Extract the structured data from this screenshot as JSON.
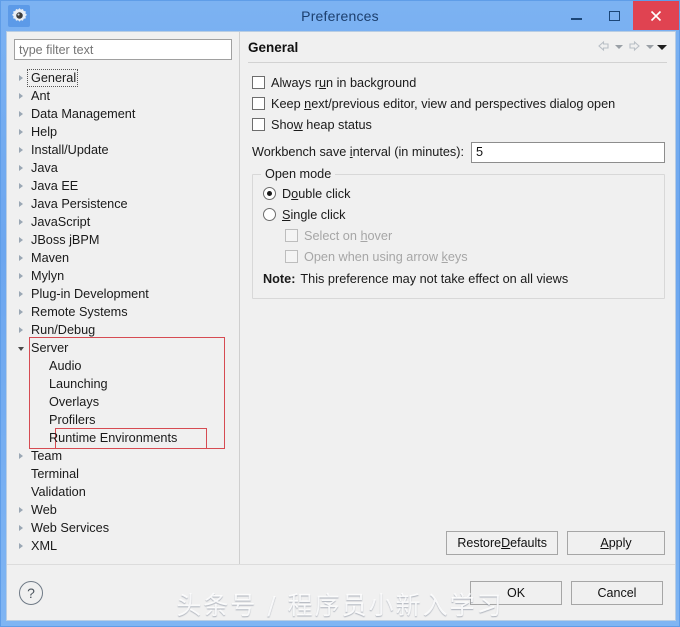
{
  "window": {
    "title": "Preferences",
    "icon": "preferences-gear-icon",
    "controls": {
      "minimize": "–",
      "maximize": "□",
      "close": "✕"
    }
  },
  "sidebar": {
    "filter": {
      "placeholder": "type filter text",
      "value": ""
    },
    "items": [
      {
        "label": "General",
        "expandable": true,
        "expanded": false,
        "level": 0,
        "focused": true
      },
      {
        "label": "Ant",
        "expandable": true,
        "expanded": false,
        "level": 0,
        "focused": false
      },
      {
        "label": "Data Management",
        "expandable": true,
        "expanded": false,
        "level": 0,
        "focused": false
      },
      {
        "label": "Help",
        "expandable": true,
        "expanded": false,
        "level": 0,
        "focused": false
      },
      {
        "label": "Install/Update",
        "expandable": true,
        "expanded": false,
        "level": 0,
        "focused": false
      },
      {
        "label": "Java",
        "expandable": true,
        "expanded": false,
        "level": 0,
        "focused": false
      },
      {
        "label": "Java EE",
        "expandable": true,
        "expanded": false,
        "level": 0,
        "focused": false
      },
      {
        "label": "Java Persistence",
        "expandable": true,
        "expanded": false,
        "level": 0,
        "focused": false
      },
      {
        "label": "JavaScript",
        "expandable": true,
        "expanded": false,
        "level": 0,
        "focused": false
      },
      {
        "label": "JBoss jBPM",
        "expandable": true,
        "expanded": false,
        "level": 0,
        "focused": false
      },
      {
        "label": "Maven",
        "expandable": true,
        "expanded": false,
        "level": 0,
        "focused": false
      },
      {
        "label": "Mylyn",
        "expandable": true,
        "expanded": false,
        "level": 0,
        "focused": false
      },
      {
        "label": "Plug-in Development",
        "expandable": true,
        "expanded": false,
        "level": 0,
        "focused": false
      },
      {
        "label": "Remote Systems",
        "expandable": true,
        "expanded": false,
        "level": 0,
        "focused": false
      },
      {
        "label": "Run/Debug",
        "expandable": true,
        "expanded": false,
        "level": 0,
        "focused": false
      },
      {
        "label": "Server",
        "expandable": true,
        "expanded": true,
        "level": 0,
        "focused": false
      },
      {
        "label": "Audio",
        "expandable": false,
        "expanded": false,
        "level": 1,
        "focused": false
      },
      {
        "label": "Launching",
        "expandable": false,
        "expanded": false,
        "level": 1,
        "focused": false
      },
      {
        "label": "Overlays",
        "expandable": false,
        "expanded": false,
        "level": 1,
        "focused": false
      },
      {
        "label": "Profilers",
        "expandable": false,
        "expanded": false,
        "level": 1,
        "focused": false
      },
      {
        "label": "Runtime Environments",
        "expandable": false,
        "expanded": false,
        "level": 1,
        "focused": false
      },
      {
        "label": "Team",
        "expandable": true,
        "expanded": false,
        "level": 0,
        "focused": false
      },
      {
        "label": "Terminal",
        "expandable": false,
        "expanded": false,
        "level": 0,
        "focused": false
      },
      {
        "label": "Validation",
        "expandable": false,
        "expanded": false,
        "level": 0,
        "focused": false
      },
      {
        "label": "Web",
        "expandable": true,
        "expanded": false,
        "level": 0,
        "focused": false
      },
      {
        "label": "Web Services",
        "expandable": true,
        "expanded": false,
        "level": 0,
        "focused": false
      },
      {
        "label": "XML",
        "expandable": true,
        "expanded": false,
        "level": 0,
        "focused": false
      }
    ],
    "annotation_color": "#d64b52"
  },
  "page": {
    "title": "General",
    "nav": {
      "back": "back-arrow",
      "back_menu": "dropdown-caret",
      "forward": "forward-arrow",
      "forward_menu": "dropdown-caret",
      "view_menu": "view-menu-caret"
    },
    "checkboxes": [
      {
        "label": "Always run in background",
        "pre": "Always r",
        "mnemonic": "u",
        "post": "n in background",
        "checked": false,
        "disabled": false
      },
      {
        "label": "Keep next/previous editor, view and perspectives dialog open",
        "pre": "Keep ",
        "mnemonic": "n",
        "post": "ext/previous editor, view and perspectives dialog open",
        "checked": false,
        "disabled": false
      },
      {
        "label": "Show heap status",
        "pre": "Sho",
        "mnemonic": "w",
        "post": " heap status",
        "checked": false,
        "disabled": false
      }
    ],
    "save_interval": {
      "pre": "Workbench save ",
      "mnemonic": "i",
      "post": "nterval (in minutes):",
      "label": "Workbench save interval (in minutes):",
      "value": "5"
    },
    "open_mode": {
      "group_title": "Open mode",
      "radios": [
        {
          "pre": "D",
          "mnemonic": "o",
          "post": "uble click",
          "label": "Double click",
          "selected": true
        },
        {
          "pre": "",
          "mnemonic": "S",
          "post": "ingle click",
          "label": "Single click",
          "selected": false
        }
      ],
      "sub_checkboxes": [
        {
          "pre": "Select on ",
          "mnemonic": "h",
          "post": "over",
          "label": "Select on hover",
          "checked": false,
          "disabled": true
        },
        {
          "pre": "Open when using arrow ",
          "mnemonic": "k",
          "post": "eys",
          "label": "Open when using arrow keys",
          "checked": false,
          "disabled": true
        }
      ],
      "note_label": "Note:",
      "note_text": "This preference may not take effect on all views"
    }
  },
  "buttons": {
    "restore_defaults": {
      "pre": "Restore ",
      "mnemonic": "D",
      "post": "efaults",
      "label": "Restore Defaults"
    },
    "apply": {
      "pre": "",
      "mnemonic": "A",
      "post": "pply",
      "label": "Apply"
    },
    "ok": "OK",
    "cancel": "Cancel",
    "help": "?"
  },
  "watermark": "头条号 / 程序员小新入学习"
}
